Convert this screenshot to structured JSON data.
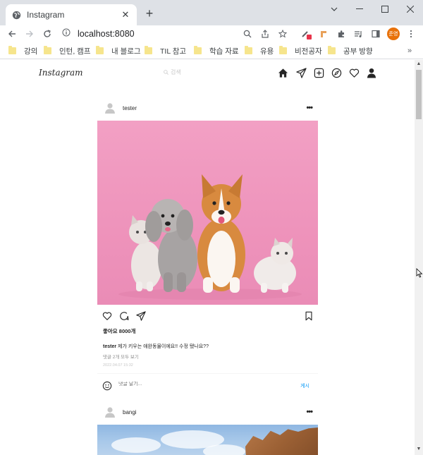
{
  "browser": {
    "tab_title": "Instagram",
    "tab_close": "✕",
    "new_tab": "+",
    "url": "localhost:8080",
    "profile_initials": "준영",
    "bookmarks": [
      "강의",
      "인턴, 캠프",
      "내 블로그",
      "TIL 참고",
      "학습 자료",
      "유용",
      "비전공자",
      "공부 방향"
    ],
    "bookmarks_more": "»"
  },
  "instagram": {
    "logo": "Instagram",
    "search_placeholder": "검색"
  },
  "posts": [
    {
      "username": "tester",
      "more": "•••",
      "likes": "좋아요 8000개",
      "caption_user": "tester",
      "caption_text": "제가 키우는 애완동물이에요!! 수정 됐나요??",
      "comments_link": "댓글 2개 모두 보기",
      "timestamp": "2022.04.07 15:32",
      "comment_placeholder": "댓글 달기...",
      "post_button": "게시"
    },
    {
      "username": "bangi",
      "more": "•••"
    }
  ],
  "colors": {
    "accent_blue": "#0095f6",
    "pink_bg": "#ee93bb",
    "profile_chip": "#e8710a"
  }
}
